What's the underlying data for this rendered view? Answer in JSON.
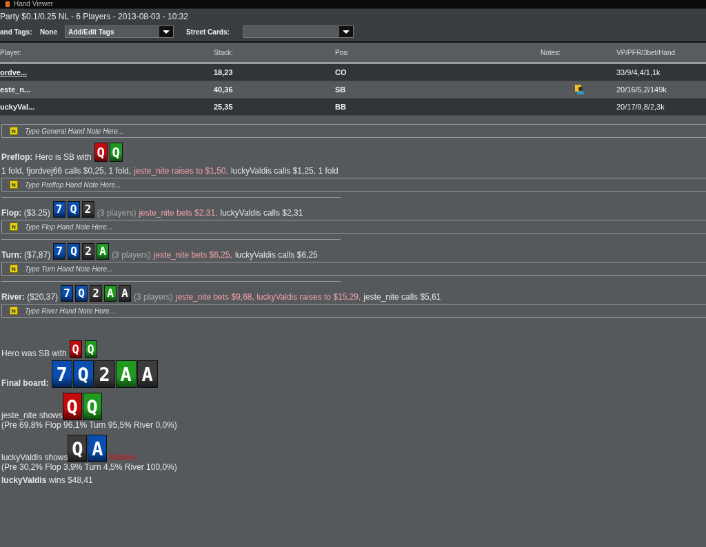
{
  "window": {
    "title": "Hand Viewer"
  },
  "hand_title": "Party $0.1/0.25 NL - 6 Players - 2013-08-03 - 10:32",
  "tags": {
    "label": "and Tags:",
    "value": "None",
    "dropdown": "Add/Edit Tags",
    "street_label": "Street Cards:"
  },
  "table": {
    "columns": [
      "Player:",
      "Stack:",
      "Pos:",
      "Notes:",
      "VP/PFR/3bet/Hand"
    ],
    "rows": [
      {
        "player": "ordve...",
        "stack": "18,23",
        "pos": "CO",
        "has_note": false,
        "stats": "33/9/4,4/1,1k"
      },
      {
        "player": "este_n...",
        "stack": "40,36",
        "pos": "SB",
        "has_note": true,
        "stats": "20/16/5,2/149k"
      },
      {
        "player": "uckyVal...",
        "stack": "25,35",
        "pos": "BB",
        "has_note": false,
        "stats": "20/17/9,8/2,3k"
      }
    ]
  },
  "general_note": {
    "icon_letter": "N",
    "placeholder": "Type General Hand Note Here..."
  },
  "streets": [
    {
      "kind": "preflop",
      "heading": "**Preflop:** Hero is SB with",
      "cards": [
        {
          "rank": "Q",
          "color": "#c40a0a"
        },
        {
          "rank": "Q",
          "color": "#1f9a1f"
        }
      ],
      "actions": [
        {
          "kind": "plain",
          "text": "1 fold, fjordvej66 calls $0,25, 1 fold,"
        },
        {
          "kind": "hero",
          "text": "jeste_nite raises to $1,50,"
        },
        {
          "kind": "plain",
          "text": "luckyValdis calls $1,25, 1 fold"
        }
      ],
      "note": {
        "icon_letter": "N",
        "placeholder": "Type Preflop Hand Note Here..."
      }
    },
    {
      "kind": "street",
      "heading": "**Flop:** ($3.25)",
      "cards": [
        {
          "rank": "7",
          "color": "#0a4fb0"
        },
        {
          "rank": "Q",
          "color": "#0a4fb0"
        },
        {
          "rank": "2",
          "color": "#3c3c3c"
        }
      ],
      "actions": [
        {
          "kind": "muted",
          "text": "(3 players)"
        },
        {
          "kind": "hero",
          "text": "jeste_nite bets $2,31,"
        },
        {
          "kind": "plain",
          "text": "luckyValdis calls $2,31"
        }
      ],
      "note": {
        "icon_letter": "N",
        "placeholder": "Type Flop Hand Note Here..."
      }
    },
    {
      "kind": "street",
      "heading": "**Turn:** ($7,87)",
      "cards": [
        {
          "rank": "7",
          "color": "#0a4fb0"
        },
        {
          "rank": "Q",
          "color": "#0a4fb0"
        },
        {
          "rank": "2",
          "color": "#3c3c3c"
        },
        {
          "rank": "A",
          "color": "#1f9a1f"
        }
      ],
      "actions": [
        {
          "kind": "muted",
          "text": "(3 players)"
        },
        {
          "kind": "hero",
          "text": "jeste_nite bets $6,25,"
        },
        {
          "kind": "plain",
          "text": "luckyValdis calls $6,25"
        }
      ],
      "note": {
        "icon_letter": "N",
        "placeholder": "Type Turn Hand Note Here..."
      }
    },
    {
      "kind": "street",
      "heading": "**River:** ($20,37)",
      "cards": [
        {
          "rank": "7",
          "color": "#0a4fb0"
        },
        {
          "rank": "Q",
          "color": "#0a4fb0"
        },
        {
          "rank": "2",
          "color": "#3c3c3c"
        },
        {
          "rank": "A",
          "color": "#1f9a1f"
        },
        {
          "rank": "A",
          "color": "#3c3c3c"
        }
      ],
      "actions": [
        {
          "kind": "muted",
          "text": "(3 players)"
        },
        {
          "kind": "hero",
          "text": "jeste_nite bets $9,68, luckyValdis raises to $15,29,"
        },
        {
          "kind": "plain",
          "text": "jeste_nite calls $5,61"
        }
      ],
      "note": {
        "icon_letter": "N",
        "placeholder": "Type River Hand Note Here..."
      }
    }
  ],
  "summary": {
    "hero": {
      "text": "Hero was SB with",
      "cards": [
        {
          "rank": "Q",
          "color": "#c40a0a"
        },
        {
          "rank": "Q",
          "color": "#1f9a1f"
        }
      ]
    },
    "board": {
      "label": "Final board:",
      "cards": [
        {
          "rank": "7",
          "color": "#0a4fb0"
        },
        {
          "rank": "Q",
          "color": "#0a4fb0"
        },
        {
          "rank": "2",
          "color": "#3c3c3c"
        },
        {
          "rank": "A",
          "color": "#1f9a1f"
        },
        {
          "rank": "A",
          "color": "#3c3c3c"
        }
      ]
    },
    "showdowns": [
      {
        "text": "jeste_nite shows",
        "cards": [
          {
            "rank": "Q",
            "color": "#c40a0a"
          },
          {
            "rank": "Q",
            "color": "#1f9a1f"
          }
        ],
        "winner": false,
        "equity": "(Pre 69,8% Flop 96,1% Turn 95,5% River 0,0%)"
      },
      {
        "text": "luckyValdis shows",
        "cards": [
          {
            "rank": "Q",
            "color": "#3c3c3c"
          },
          {
            "rank": "A",
            "color": "#0a4fb0"
          }
        ],
        "winner": true,
        "winner_label": "Winner",
        "equity": "(Pre 30,2% Flop 3,9% Turn 4,5% River 100,0%)"
      }
    ],
    "result": "**luckyValdis** wins $48,41"
  }
}
